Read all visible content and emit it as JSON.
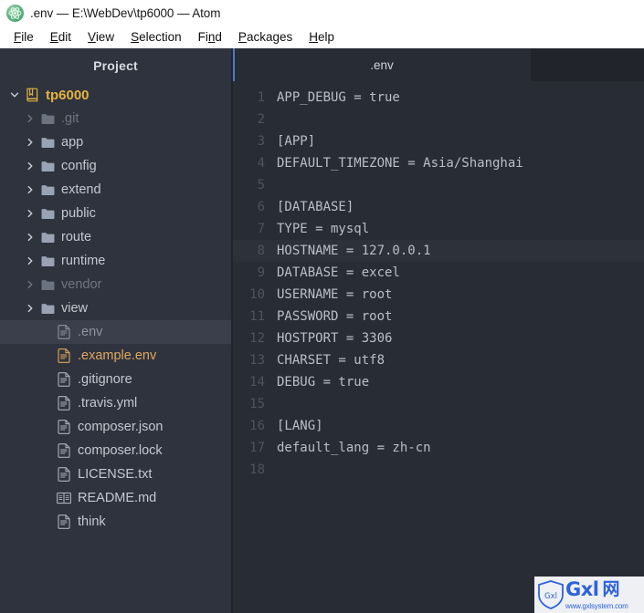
{
  "window": {
    "title": ".env — E:\\WebDev\\tp6000 — Atom",
    "app_icon": "atom-logo-icon"
  },
  "menubar": {
    "items": [
      {
        "label": "File",
        "pre": "",
        "key": "F",
        "post": "ile"
      },
      {
        "label": "Edit",
        "pre": "",
        "key": "E",
        "post": "dit"
      },
      {
        "label": "View",
        "pre": "",
        "key": "V",
        "post": "iew"
      },
      {
        "label": "Selection",
        "pre": "",
        "key": "S",
        "post": "election"
      },
      {
        "label": "Find",
        "pre": "Fi",
        "key": "n",
        "post": "d"
      },
      {
        "label": "Packages",
        "pre": "",
        "key": "P",
        "post": "ackages"
      },
      {
        "label": "Help",
        "pre": "",
        "key": "H",
        "post": "elp"
      }
    ]
  },
  "sidebar": {
    "title": "Project",
    "tree": [
      {
        "label": "tp6000",
        "icon": "repo-icon",
        "depth": 0,
        "twisty": "down",
        "state": "root",
        "expanded": true
      },
      {
        "label": ".git",
        "icon": "folder-icon",
        "depth": 1,
        "twisty": "right",
        "state": "ignored",
        "expanded": false
      },
      {
        "label": "app",
        "icon": "folder-icon",
        "depth": 1,
        "twisty": "right",
        "state": "normal",
        "expanded": false
      },
      {
        "label": "config",
        "icon": "folder-icon",
        "depth": 1,
        "twisty": "right",
        "state": "normal",
        "expanded": false
      },
      {
        "label": "extend",
        "icon": "folder-icon",
        "depth": 1,
        "twisty": "right",
        "state": "normal",
        "expanded": false
      },
      {
        "label": "public",
        "icon": "folder-icon",
        "depth": 1,
        "twisty": "right",
        "state": "normal",
        "expanded": false
      },
      {
        "label": "route",
        "icon": "folder-icon",
        "depth": 1,
        "twisty": "right",
        "state": "normal",
        "expanded": false
      },
      {
        "label": "runtime",
        "icon": "folder-icon",
        "depth": 1,
        "twisty": "right",
        "state": "normal",
        "expanded": false
      },
      {
        "label": "vendor",
        "icon": "folder-icon",
        "depth": 1,
        "twisty": "right",
        "state": "ignored",
        "expanded": false
      },
      {
        "label": "view",
        "icon": "folder-icon",
        "depth": 1,
        "twisty": "right",
        "state": "normal",
        "expanded": false
      },
      {
        "label": ".env",
        "icon": "file-icon",
        "depth": 2,
        "twisty": "none",
        "state": "selected",
        "expanded": false
      },
      {
        "label": ".example.env",
        "icon": "file-icon",
        "depth": 2,
        "twisty": "none",
        "state": "modified",
        "expanded": false
      },
      {
        "label": ".gitignore",
        "icon": "file-icon",
        "depth": 2,
        "twisty": "none",
        "state": "normal",
        "expanded": false
      },
      {
        "label": ".travis.yml",
        "icon": "file-icon",
        "depth": 2,
        "twisty": "none",
        "state": "normal",
        "expanded": false
      },
      {
        "label": "composer.json",
        "icon": "file-icon",
        "depth": 2,
        "twisty": "none",
        "state": "normal",
        "expanded": false
      },
      {
        "label": "composer.lock",
        "icon": "file-icon",
        "depth": 2,
        "twisty": "none",
        "state": "normal",
        "expanded": false
      },
      {
        "label": "LICENSE.txt",
        "icon": "file-icon",
        "depth": 2,
        "twisty": "none",
        "state": "normal",
        "expanded": false
      },
      {
        "label": "README.md",
        "icon": "book-icon",
        "depth": 2,
        "twisty": "none",
        "state": "normal",
        "expanded": false
      },
      {
        "label": "think",
        "icon": "file-icon",
        "depth": 2,
        "twisty": "none",
        "state": "normal",
        "expanded": false
      }
    ]
  },
  "tabs": [
    {
      "label": ".env",
      "active": true
    }
  ],
  "editor": {
    "cursor_line": 8,
    "lines": [
      {
        "n": "1",
        "text": "APP_DEBUG = true"
      },
      {
        "n": "2",
        "text": ""
      },
      {
        "n": "3",
        "text": "[APP]"
      },
      {
        "n": "4",
        "text": "DEFAULT_TIMEZONE = Asia/Shanghai"
      },
      {
        "n": "5",
        "text": ""
      },
      {
        "n": "6",
        "text": "[DATABASE]"
      },
      {
        "n": "7",
        "text": "TYPE = mysql"
      },
      {
        "n": "8",
        "text": "HOSTNAME = 127.0.0.1"
      },
      {
        "n": "9",
        "text": "DATABASE = excel"
      },
      {
        "n": "10",
        "text": "USERNAME = root"
      },
      {
        "n": "11",
        "text": "PASSWORD = root"
      },
      {
        "n": "12",
        "text": "HOSTPORT = 3306"
      },
      {
        "n": "13",
        "text": "CHARSET = utf8"
      },
      {
        "n": "14",
        "text": "DEBUG = true"
      },
      {
        "n": "15",
        "text": ""
      },
      {
        "n": "16",
        "text": "[LANG]"
      },
      {
        "n": "17",
        "text": "default_lang = zh-cn"
      },
      {
        "n": "18",
        "text": ""
      }
    ]
  },
  "watermark": {
    "shield_text": "Gxl",
    "brand": "Gxl",
    "brand_cn": "网",
    "url": "www.gxlsystem.com"
  },
  "colors": {
    "editor_bg": "#282c34",
    "sidebar_bg": "#2f333d",
    "tabbar_bg": "#21252b",
    "tab_accent": "#4d78cc",
    "text": "#c3c8d1",
    "modified": "#e0a760",
    "root": "#e3b341",
    "linenumber": "#4d5360",
    "watermark_blue": "#2f63d8"
  }
}
